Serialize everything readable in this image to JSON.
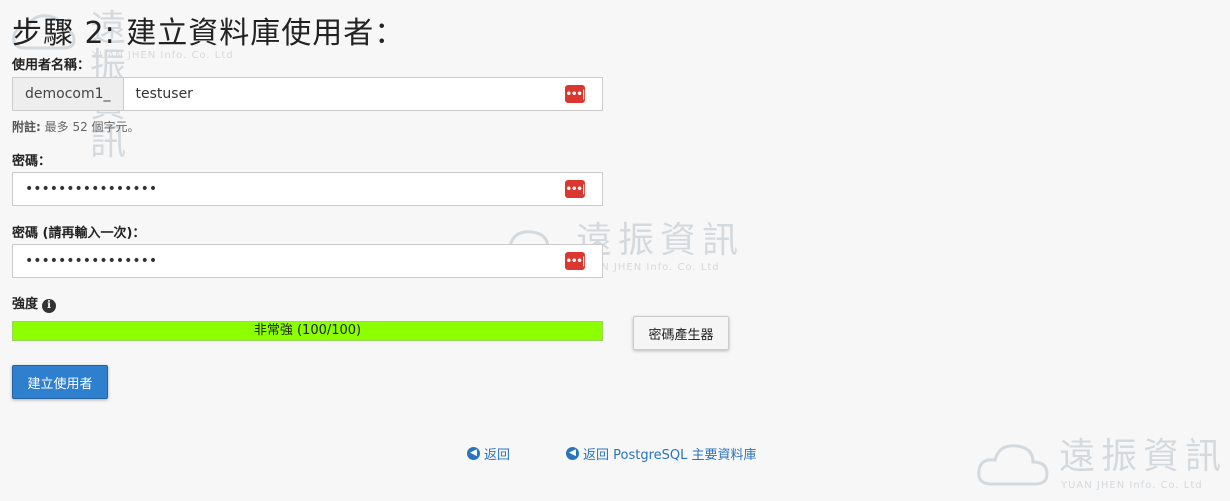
{
  "page_title": "步驟 2: 建立資料庫使用者：",
  "username": {
    "label": "使用者名稱：",
    "prefix": "democom1_",
    "value": "testuser"
  },
  "note": {
    "bold": "附註:",
    "text": "最多 52 個字元。"
  },
  "password": {
    "label": "密碼：",
    "value": "••••••••••••••••"
  },
  "password_confirm": {
    "label": "密碼 (請再輸入一次)：",
    "value": "••••••••••••••••"
  },
  "strength": {
    "label": "強度",
    "bar_text": "非常強 (100/100)",
    "level": 1.0,
    "color": "#8cff00"
  },
  "buttons": {
    "generator": "密碼產生器",
    "create": "建立使用者"
  },
  "links": {
    "back": "返回",
    "back_postgres": "返回 PostgreSQL 主要資料庫"
  },
  "watermark": {
    "cn": "遠振資訊",
    "en": "YUAN JHEN Info. Co. Ltd"
  },
  "keepass_icon_text": "•••|",
  "info_icon_glyph": "i",
  "arrow_icon_glyph": "◀"
}
